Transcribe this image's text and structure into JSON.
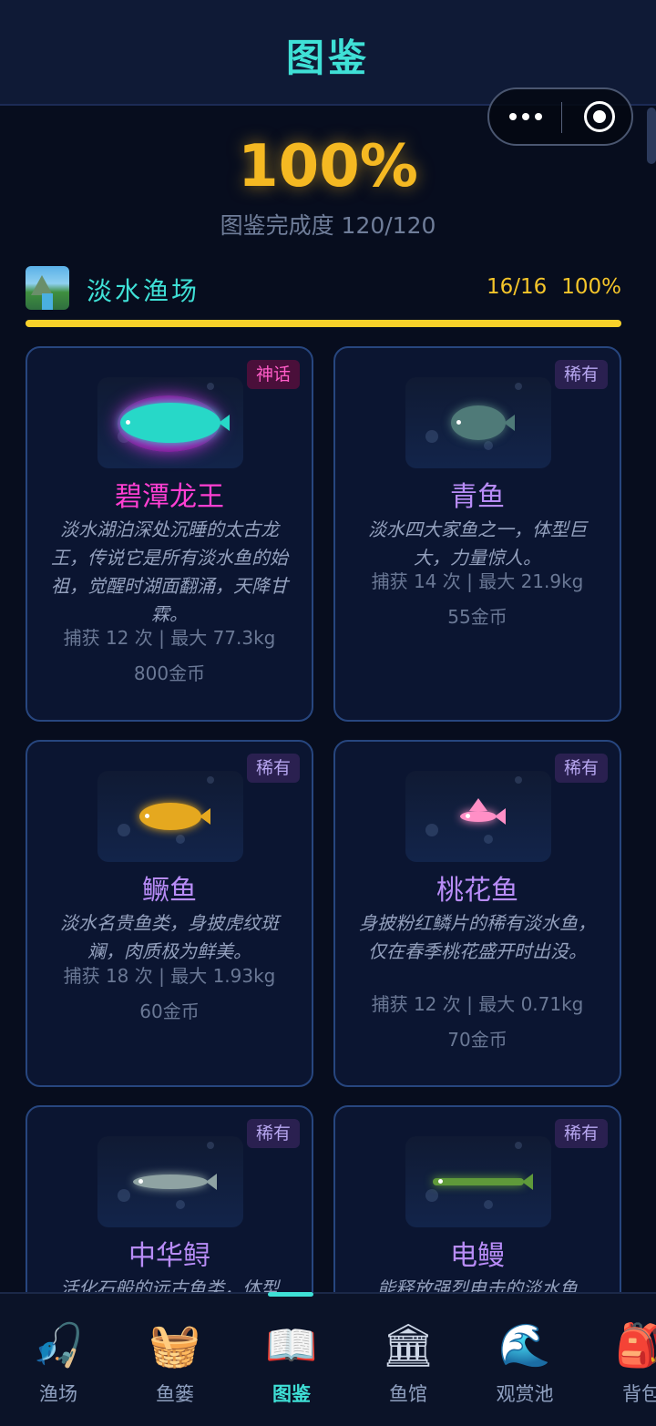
{
  "header": {
    "title": "图鉴"
  },
  "summary": {
    "percent": "100%",
    "completion_label": "图鉴完成度 120/120"
  },
  "section": {
    "title": "淡水渔场",
    "count": "16/16",
    "percent": "100%",
    "progress_fraction": 1.0,
    "progress_color": "#f8d12a"
  },
  "fish": [
    {
      "name": "碧潭龙王",
      "rarity": "神话",
      "rarity_type": "mythic",
      "name_color": "#ff3fd2",
      "desc": "淡水湖泊深处沉睡的太古龙王，传说它是所有淡水鱼的始祖，觉醒时湖面翻涌，天降甘霖。",
      "stats": "捕获 12 次 | 最大 77.3kg",
      "coins": "800金币"
    },
    {
      "name": "青鱼",
      "rarity": "稀有",
      "rarity_type": "rare",
      "name_color": "#b88cf7",
      "desc": "淡水四大家鱼之一，体型巨大，力量惊人。",
      "stats": "捕获 14 次 | 最大 21.9kg",
      "coins": "55金币"
    },
    {
      "name": "鳜鱼",
      "rarity": "稀有",
      "rarity_type": "rare",
      "name_color": "#b88cf7",
      "desc": "淡水名贵鱼类，身披虎纹斑斓，肉质极为鲜美。",
      "stats": "捕获 18 次 | 最大 1.93kg",
      "coins": "60金币"
    },
    {
      "name": "桃花鱼",
      "rarity": "稀有",
      "rarity_type": "rare",
      "name_color": "#b88cf7",
      "desc": "身披粉红鳞片的稀有淡水鱼，仅在春季桃花盛开时出没。",
      "stats": "捕获 12 次 | 最大 0.71kg",
      "coins": "70金币"
    },
    {
      "name": "中华鲟",
      "rarity": "稀有",
      "rarity_type": "rare",
      "name_color": "#b88cf7",
      "desc": "活化石般的远古鱼类，体型",
      "stats": "",
      "coins": ""
    },
    {
      "name": "电鳗",
      "rarity": "稀有",
      "rarity_type": "rare",
      "name_color": "#b88cf7",
      "desc": "能释放强烈电击的淡水鱼",
      "stats": "",
      "coins": ""
    }
  ],
  "nav": [
    {
      "label": "渔场",
      "icon": "fishing-rod-icon",
      "glyph": "🎣"
    },
    {
      "label": "鱼篓",
      "icon": "basket-icon",
      "glyph": "🧺"
    },
    {
      "label": "图鉴",
      "icon": "book-icon",
      "glyph": "📖",
      "active": true
    },
    {
      "label": "鱼馆",
      "icon": "museum-icon",
      "glyph": "🏛"
    },
    {
      "label": "观赏池",
      "icon": "wave-icon",
      "glyph": "🌊"
    },
    {
      "label": "背包",
      "icon": "backpack-icon",
      "glyph": "🎒"
    }
  ]
}
